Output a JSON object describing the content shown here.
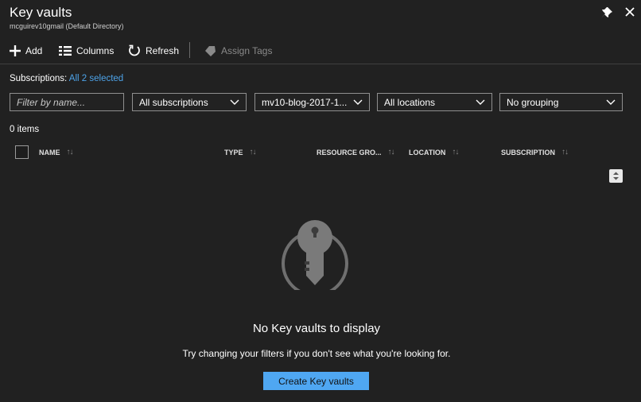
{
  "header": {
    "title": "Key vaults",
    "subtitle": "mcguirev10gmail (Default Directory)",
    "pin_icon": "pin-icon",
    "close_icon": "close-icon"
  },
  "toolbar": {
    "add_label": "Add",
    "columns_label": "Columns",
    "refresh_label": "Refresh",
    "assign_tags_label": "Assign Tags"
  },
  "subscriptions": {
    "label": "Subscriptions:",
    "link": "All 2 selected"
  },
  "filters": {
    "name_placeholder": "Filter by name...",
    "subscriptions_value": "All subscriptions",
    "resource_group_value": "mv10-blog-2017-1...",
    "locations_value": "All locations",
    "grouping_value": "No grouping"
  },
  "list": {
    "count_text": "0 items",
    "columns": [
      "NAME",
      "TYPE",
      "RESOURCE GRO...",
      "LOCATION",
      "SUBSCRIPTION"
    ]
  },
  "empty_state": {
    "icon": "key-icon",
    "title": "No Key vaults to display",
    "hint": "Try changing your filters if you don't see what you're looking for.",
    "button_label": "Create Key vaults"
  },
  "colors": {
    "background": "#212121",
    "accent": "#4da3e8",
    "button": "#4fa7f2"
  }
}
